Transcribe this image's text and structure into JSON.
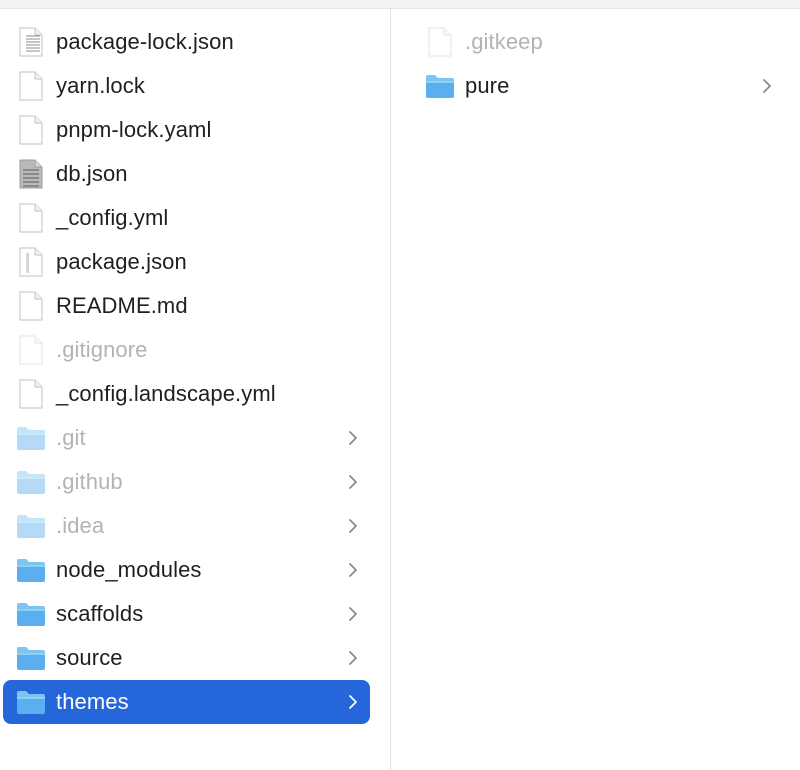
{
  "columns": [
    {
      "items": [
        {
          "name": "package-lock.json",
          "kind": "file-lines",
          "hidden": false,
          "folder": false
        },
        {
          "name": "yarn.lock",
          "kind": "file",
          "hidden": false,
          "folder": false
        },
        {
          "name": "pnpm-lock.yaml",
          "kind": "file",
          "hidden": false,
          "folder": false
        },
        {
          "name": "db.json",
          "kind": "file-binary",
          "hidden": false,
          "folder": false
        },
        {
          "name": "_config.yml",
          "kind": "file",
          "hidden": false,
          "folder": false
        },
        {
          "name": "package.json",
          "kind": "file-ruled",
          "hidden": false,
          "folder": false
        },
        {
          "name": "README.md",
          "kind": "file",
          "hidden": false,
          "folder": false
        },
        {
          "name": ".gitignore",
          "kind": "file",
          "hidden": true,
          "folder": false
        },
        {
          "name": "_config.landscape.yml",
          "kind": "file",
          "hidden": false,
          "folder": false
        },
        {
          "name": ".git",
          "kind": "folder",
          "hidden": true,
          "folder": true
        },
        {
          "name": ".github",
          "kind": "folder",
          "hidden": true,
          "folder": true
        },
        {
          "name": ".idea",
          "kind": "folder",
          "hidden": true,
          "folder": true
        },
        {
          "name": "node_modules",
          "kind": "folder",
          "hidden": false,
          "folder": true
        },
        {
          "name": "scaffolds",
          "kind": "folder",
          "hidden": false,
          "folder": true
        },
        {
          "name": "source",
          "kind": "folder",
          "hidden": false,
          "folder": true
        },
        {
          "name": "themes",
          "kind": "folder",
          "hidden": false,
          "folder": true,
          "selected": true
        }
      ]
    },
    {
      "items": [
        {
          "name": ".gitkeep",
          "kind": "file",
          "hidden": true,
          "folder": false
        },
        {
          "name": "pure",
          "kind": "folder",
          "hidden": false,
          "folder": true
        }
      ]
    }
  ],
  "colors": {
    "selection": "#2566db",
    "folder_top": "#7cc4f2",
    "folder_body": "#5aaff0",
    "hidden_text": "#b3b3b3",
    "text": "#1f1f1f"
  }
}
